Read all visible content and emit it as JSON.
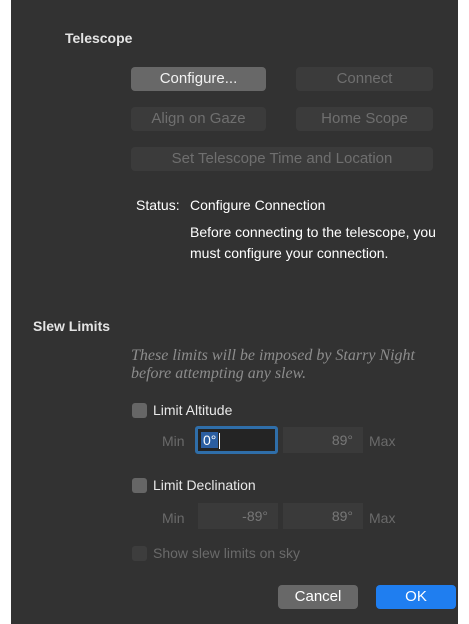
{
  "telescope": {
    "section_title": "Telescope",
    "configure_label": "Configure...",
    "connect_label": "Connect",
    "align_label": "Align on Gaze",
    "home_label": "Home Scope",
    "set_time_label": "Set Telescope Time and Location",
    "status_label": "Status:",
    "status_value": "Configure Connection",
    "status_message_line1": "Before connecting to the telescope, you",
    "status_message_line2": "must configure your connection."
  },
  "slew_limits": {
    "section_title": "Slew Limits",
    "description_line1": "These limits will be imposed by Starry Night",
    "description_line2": "before attempting any slew.",
    "limit_altitude_label": "Limit Altitude",
    "altitude_min_label": "Min",
    "altitude_min_value": "0°",
    "altitude_max_value": "89°",
    "altitude_max_label": "Max",
    "limit_declination_label": "Limit Declination",
    "declination_min_label": "Min",
    "declination_min_value": "-89°",
    "declination_max_value": "89°",
    "declination_max_label": "Max",
    "show_on_sky_label": "Show slew limits on sky"
  },
  "footer": {
    "cancel_label": "Cancel",
    "ok_label": "OK"
  },
  "colors": {
    "panel_bg": "#323232",
    "accent": "#1f7ef0",
    "focus_ring": "#2f6ea9"
  }
}
